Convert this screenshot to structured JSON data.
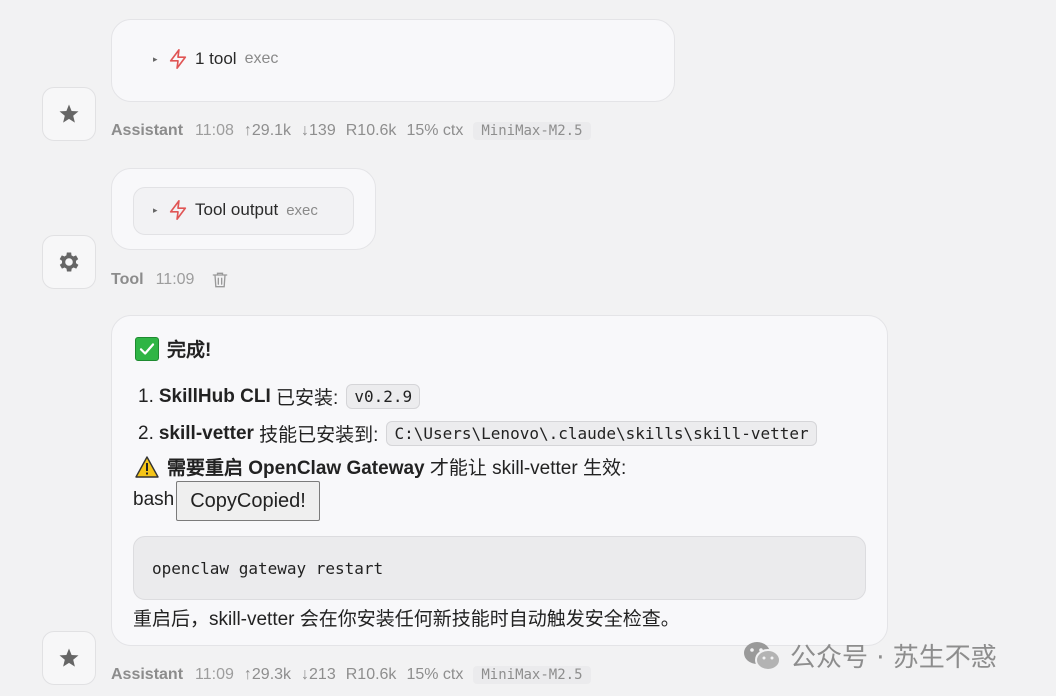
{
  "messages": [
    {
      "tool_summary": {
        "count_label": "1 tool",
        "name": "exec"
      },
      "meta": {
        "role": "Assistant",
        "time": "11:08",
        "up": "↑29.1k",
        "down": "↓139",
        "r": "R10.6k",
        "ctx": "15% ctx",
        "model": "MiniMax-M2.5"
      }
    },
    {
      "tool_summary": {
        "count_label": "Tool output",
        "name": "exec"
      },
      "meta": {
        "role": "Tool",
        "time": "11:09"
      }
    },
    {
      "content": {
        "heading_emoji": "✅",
        "heading": "完成!",
        "item1_num": "1.",
        "item1_bold": "SkillHub CLI",
        "item1_text": " 已安装:",
        "item1_code": "v0.2.9",
        "item2_num": "2.",
        "item2_bold": "skill-vetter",
        "item2_text": " 技能已安装到:",
        "item2_code": "C:\\Users\\Lenovo\\.claude\\skills\\skill-vetter",
        "warn_emoji": "⚠️",
        "warn_bold": "需要重启 OpenClaw Gateway",
        "warn_text": " 才能让 skill-vetter 生效:",
        "code_lang": "bash",
        "copy_label": "CopyCopied!",
        "code": "openclaw gateway restart",
        "footer": "重启后，skill-vetter 会在你安装任何新技能时自动触发安全检查。"
      },
      "meta": {
        "role": "Assistant",
        "time": "11:09",
        "up": "↑29.3k",
        "down": "↓213",
        "r": "R10.6k",
        "ctx": "15% ctx",
        "model": "MiniMax-M2.5"
      }
    }
  ],
  "watermark": "公众号 · 苏生不惑",
  "icons": {
    "assistant": "star-icon",
    "tool": "gear-icon",
    "tool_call": "lightning-icon",
    "delete": "trash-icon",
    "expand": "caret-right-icon",
    "watermark": "wechat-icon"
  },
  "colors": {
    "bolt": "#e05555",
    "check": "#2fb545",
    "warn": "#f5c518"
  }
}
